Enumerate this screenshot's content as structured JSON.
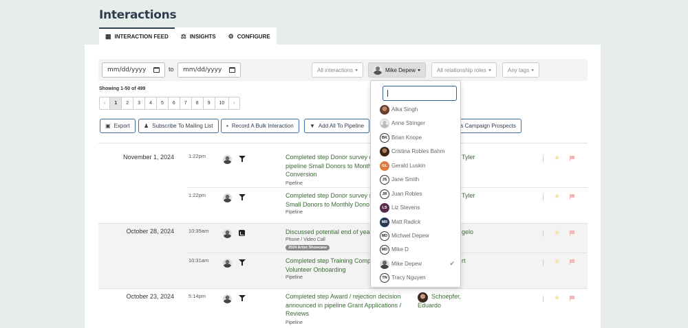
{
  "page": {
    "title": "Interactions"
  },
  "tabs": [
    {
      "label": "INTERACTION FEED",
      "icon": "calendar-icon",
      "active": true
    },
    {
      "label": "INSIGHTS",
      "icon": "chart-icon",
      "active": false
    },
    {
      "label": "CONFIGURE",
      "icon": "gears-icon",
      "active": false
    }
  ],
  "filters": {
    "date_from_placeholder": "mm/dd/yyyy",
    "date_to_placeholder": "mm/dd/yyyy",
    "to_label": "to",
    "interactions": "All interactions",
    "user": "Mike Depew",
    "roles": "All relationship roles",
    "tags": "Any tags"
  },
  "showing": "Showing 1-50 of 499",
  "pager": {
    "prev": "‹",
    "next": "›",
    "pages": [
      "1",
      "2",
      "3",
      "4",
      "5",
      "6",
      "7",
      "8",
      "9",
      "10"
    ],
    "current": "1"
  },
  "actions": {
    "export": "Export",
    "subscribe": "Subscribe To Mailing List",
    "record_bulk": "Record A Bulk Interaction",
    "add_pipeline": "Add All To Pipeline",
    "add_campaign": "ld As Campaign Prospects"
  },
  "feed": {
    "days": [
      {
        "date": "November 1, 2024"
      },
      {
        "date": "October 28, 2024"
      },
      {
        "date": "October 23, 2024"
      }
    ],
    "rows": [
      {
        "time": "1:22pm",
        "type": "pipeline",
        "desc1": "Completed step Donor survey c",
        "desc2": "pipeline Small Donors to Month",
        "desc3": "Conversion",
        "sub": "Pipeline",
        "partner": "Tyler"
      },
      {
        "time": "1:22pm",
        "type": "pipeline",
        "desc1": "Completed step Donor survey s",
        "desc2": "Small Donors to Monthly Dono",
        "sub": "Pipeline",
        "partner": "Tyler"
      },
      {
        "time": "10:35am",
        "type": "phone",
        "desc1": "Discussed potential end of yea",
        "sub": "Phone / Video Call",
        "tag": "2024 Artist Showcase",
        "partner": "gelo"
      },
      {
        "time": "10:31am",
        "type": "pipeline",
        "desc1": "Completed step Training Comp",
        "desc2": "Volunteer Onboarding",
        "sub": "Pipeline",
        "partner": "rt"
      },
      {
        "time": "5:14pm",
        "type": "pipeline",
        "desc1": "Completed step Award / rejection decision",
        "desc2": "announced in pipeline Grant Applications /",
        "desc3": "Reviews",
        "sub": "Pipeline",
        "partner": "Schoepfer,",
        "partner2": "Eduardo"
      }
    ]
  },
  "user_menu": {
    "items": [
      {
        "name": "Alka Singh",
        "avatar": "photo"
      },
      {
        "name": "Anne Stringer",
        "avatar": "placeholder"
      },
      {
        "name": "Brian Knope",
        "avatar": "BK"
      },
      {
        "name": "Cristina Robles Bahm",
        "avatar": "photo"
      },
      {
        "name": "Gerald Luskin",
        "avatar": "GL"
      },
      {
        "name": "Jane Smith",
        "avatar": "JS"
      },
      {
        "name": "Juan Robles",
        "avatar": "JR"
      },
      {
        "name": "Liz Stevens",
        "avatar": "LS"
      },
      {
        "name": "Matt Radick",
        "avatar": "MR"
      },
      {
        "name": "Michael Depew",
        "avatar": "MD"
      },
      {
        "name": "Mike D",
        "avatar": "MD"
      },
      {
        "name": "Mike Depew",
        "avatar": "photo",
        "selected": true
      },
      {
        "name": "Tracy Nguyen",
        "avatar": "TN"
      }
    ]
  }
}
